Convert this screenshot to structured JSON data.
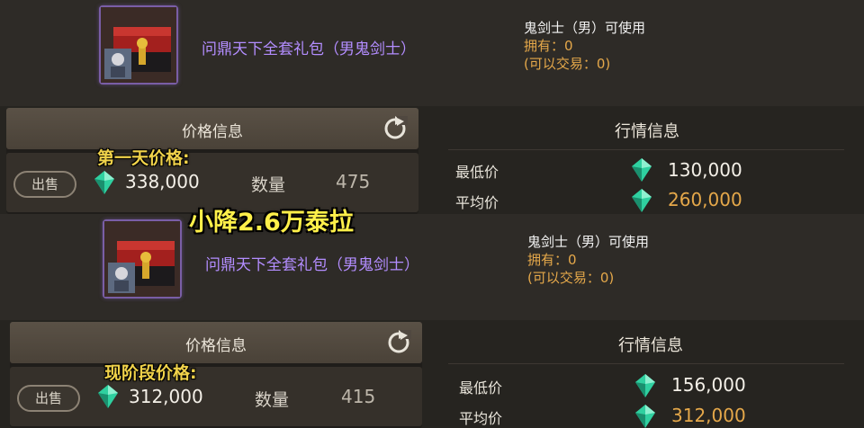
{
  "panels": [
    {
      "item_name": "问鼎天下全套礼包（男鬼剑士）",
      "usable_by": "鬼剑士（男）可使用",
      "owned": "拥有：0",
      "tradeable": "(可以交易：0)",
      "price_header": "价格信息",
      "annotation": "第一天价格:",
      "sell_label": "出售",
      "price": "338,000",
      "qty_label": "数量",
      "qty": "475",
      "market_title": "行情信息",
      "low_label": "最低价",
      "low_value": "130,000",
      "avg_label": "平均价",
      "avg_value": "260,000"
    },
    {
      "item_name": "问鼎天下全套礼包（男鬼剑士）",
      "usable_by": "鬼剑士（男）可使用",
      "owned": "拥有：0",
      "tradeable": "(可以交易：0)",
      "price_header": "价格信息",
      "annotation": "现阶段价格:",
      "sell_label": "出售",
      "price": "312,000",
      "qty_label": "数量",
      "qty": "415",
      "market_title": "行情信息",
      "low_label": "最低价",
      "low_value": "156,000",
      "avg_label": "平均价",
      "avg_value": "312,000"
    }
  ],
  "caption": "小降2.6万泰拉",
  "colors": {
    "item_name": "#b38dff",
    "orange_text": "#e5a84a",
    "caption": "#fff04a",
    "gem": "#2fd0a0"
  },
  "icons": [
    "gift-box-icon",
    "refresh-icon",
    "gem-currency-icon"
  ]
}
